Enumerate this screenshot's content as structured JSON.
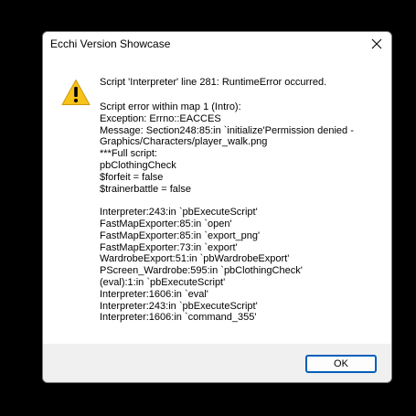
{
  "window": {
    "title": "Ecchi Version Showcase",
    "close_icon": "close-icon"
  },
  "message": {
    "icon": "warning-icon",
    "heading": "Script 'Interpreter' line 281: RuntimeError occurred.",
    "details": [
      "Script error within map 1 (Intro):",
      "Exception: Errno::EACCES",
      "Message: Section248:85:in `initialize'Permission denied -",
      "Graphics/Characters/player_walk.png",
      "***Full script:",
      "pbClothingCheck",
      "$forfeit = false",
      "$trainerbattle = false",
      "",
      "Interpreter:243:in `pbExecuteScript'",
      "FastMapExporter:85:in `open'",
      "FastMapExporter:85:in `export_png'",
      "FastMapExporter:73:in `export'",
      "WardrobeExport:51:in `pbWardrobeExport'",
      "PScreen_Wardrobe:595:in `pbClothingCheck'",
      "(eval):1:in `pbExecuteScript'",
      "Interpreter:1606:in `eval'",
      "Interpreter:243:in `pbExecuteScript'",
      "Interpreter:1606:in `command_355'"
    ]
  },
  "buttons": {
    "ok_label": "OK"
  },
  "colors": {
    "accent": "#005fb8",
    "warning": "#f7c21a"
  }
}
